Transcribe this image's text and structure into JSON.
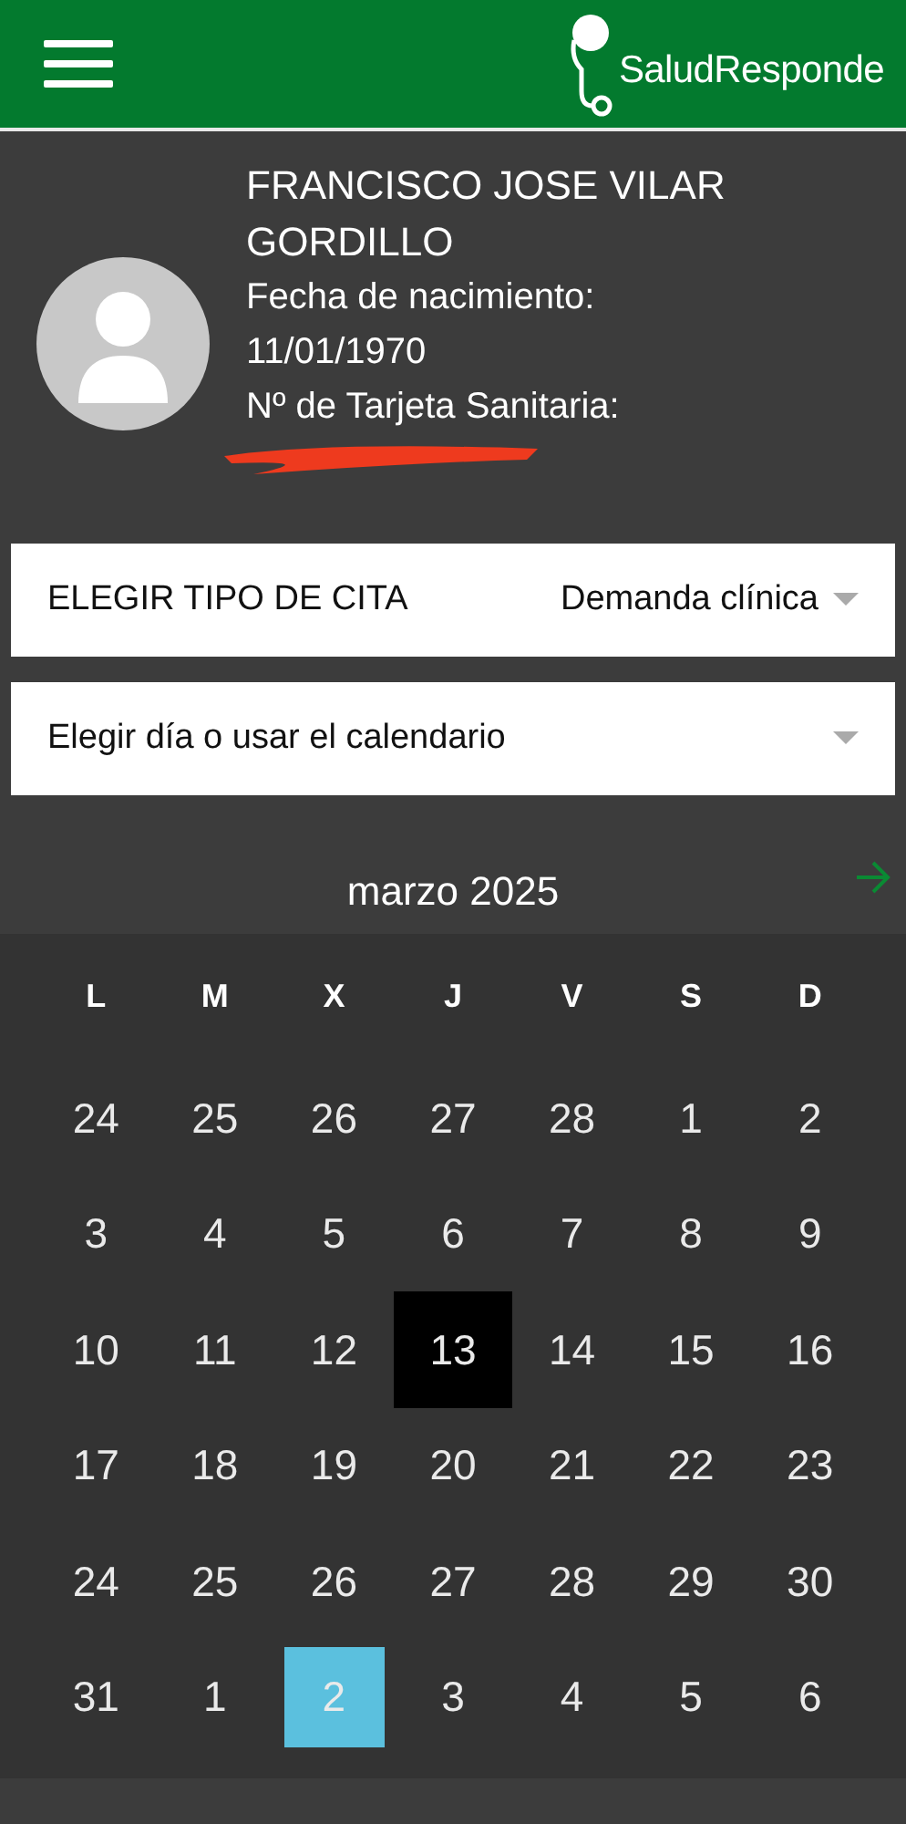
{
  "header": {
    "logo_text": "SaludResponde"
  },
  "profile": {
    "name": "FRANCISCO JOSE VILAR GORDILLO",
    "birth_label": "Fecha de nacimiento:",
    "birth_date": "11/01/1970",
    "card_label": "Nº de Tarjeta Sanitaria:",
    "card_redacted": true
  },
  "appointment_type": {
    "label": "ELEGIR TIPO DE CITA",
    "value": "Demanda clínica"
  },
  "day_select": {
    "placeholder": "Elegir día o usar el calendario"
  },
  "calendar": {
    "month": "marzo 2025",
    "weekdays": [
      "L",
      "M",
      "X",
      "J",
      "V",
      "S",
      "D"
    ],
    "weeks": [
      [
        {
          "day": "24",
          "today": false,
          "selected": false
        },
        {
          "day": "25",
          "today": false,
          "selected": false
        },
        {
          "day": "26",
          "today": false,
          "selected": false
        },
        {
          "day": "27",
          "today": false,
          "selected": false
        },
        {
          "day": "28",
          "today": false,
          "selected": false
        },
        {
          "day": "1",
          "today": false,
          "selected": false
        },
        {
          "day": "2",
          "today": false,
          "selected": false
        }
      ],
      [
        {
          "day": "3",
          "today": false,
          "selected": false
        },
        {
          "day": "4",
          "today": false,
          "selected": false
        },
        {
          "day": "5",
          "today": false,
          "selected": false
        },
        {
          "day": "6",
          "today": false,
          "selected": false
        },
        {
          "day": "7",
          "today": false,
          "selected": false
        },
        {
          "day": "8",
          "today": false,
          "selected": false
        },
        {
          "day": "9",
          "today": false,
          "selected": false
        }
      ],
      [
        {
          "day": "10",
          "today": false,
          "selected": false
        },
        {
          "day": "11",
          "today": false,
          "selected": false
        },
        {
          "day": "12",
          "today": false,
          "selected": false
        },
        {
          "day": "13",
          "today": true,
          "selected": false
        },
        {
          "day": "14",
          "today": false,
          "selected": false
        },
        {
          "day": "15",
          "today": false,
          "selected": false
        },
        {
          "day": "16",
          "today": false,
          "selected": false
        }
      ],
      [
        {
          "day": "17",
          "today": false,
          "selected": false
        },
        {
          "day": "18",
          "today": false,
          "selected": false
        },
        {
          "day": "19",
          "today": false,
          "selected": false
        },
        {
          "day": "20",
          "today": false,
          "selected": false
        },
        {
          "day": "21",
          "today": false,
          "selected": false
        },
        {
          "day": "22",
          "today": false,
          "selected": false
        },
        {
          "day": "23",
          "today": false,
          "selected": false
        }
      ],
      [
        {
          "day": "24",
          "today": false,
          "selected": false
        },
        {
          "day": "25",
          "today": false,
          "selected": false
        },
        {
          "day": "26",
          "today": false,
          "selected": false
        },
        {
          "day": "27",
          "today": false,
          "selected": false
        },
        {
          "day": "28",
          "today": false,
          "selected": false
        },
        {
          "day": "29",
          "today": false,
          "selected": false
        },
        {
          "day": "30",
          "today": false,
          "selected": false
        }
      ],
      [
        {
          "day": "31",
          "today": false,
          "selected": false
        },
        {
          "day": "1",
          "today": false,
          "selected": false
        },
        {
          "day": "2",
          "today": false,
          "selected": true
        },
        {
          "day": "3",
          "today": false,
          "selected": false
        },
        {
          "day": "4",
          "today": false,
          "selected": false
        },
        {
          "day": "5",
          "today": false,
          "selected": false
        },
        {
          "day": "6",
          "today": false,
          "selected": false
        }
      ]
    ]
  }
}
